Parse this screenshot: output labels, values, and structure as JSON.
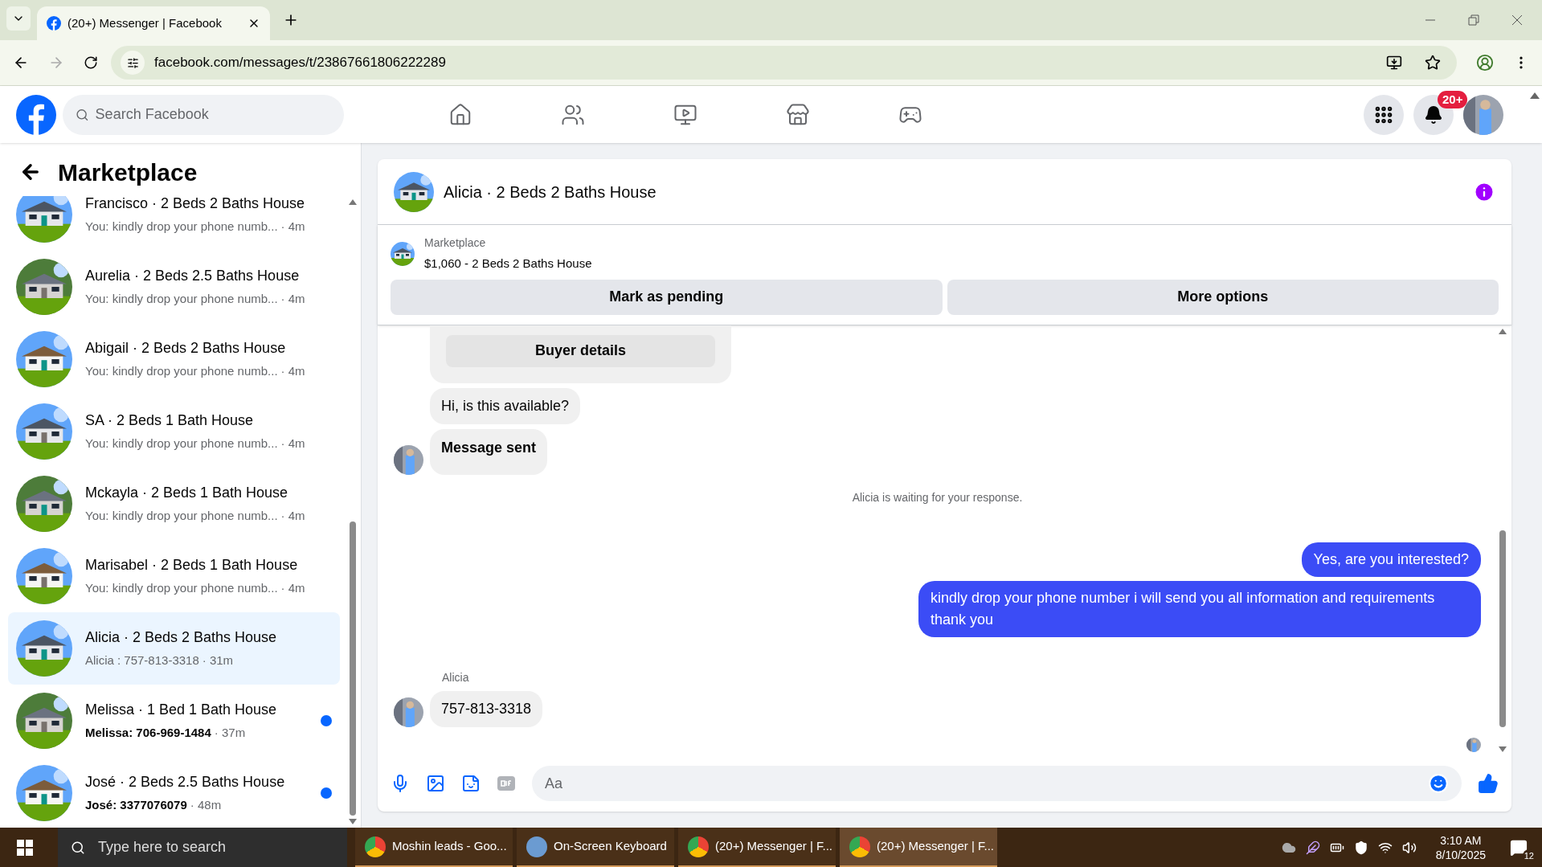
{
  "browser": {
    "tabs": [
      {
        "title": "(20+) Messenger | Facebook",
        "selected": true
      }
    ],
    "url": "facebook.com/messages/t/23867661806222289"
  },
  "header": {
    "search_placeholder": "Search Facebook",
    "notification_badge": "20+"
  },
  "sidebar": {
    "title": "Marketplace",
    "conversations": [
      {
        "name": "Francisco · 2 Beds 2 Baths House",
        "preview": "You: kindly drop your phone numb...",
        "time": "· 4m",
        "selected": false,
        "unread": false
      },
      {
        "name": "Aurelia · 2 Beds 2.5 Baths House",
        "preview": "You: kindly drop your phone numb...",
        "time": "· 4m",
        "selected": false,
        "unread": false
      },
      {
        "name": "Abigail · 2 Beds 2 Baths House",
        "preview": "You: kindly drop your phone numb...",
        "time": "· 4m",
        "selected": false,
        "unread": false
      },
      {
        "name": "SA · 2 Beds 1 Bath House",
        "preview": "You: kindly drop your phone numb...",
        "time": "· 4m",
        "selected": false,
        "unread": false
      },
      {
        "name": "Mckayla · 2 Beds 1 Bath House",
        "preview": "You: kindly drop your phone numb...",
        "time": "· 4m",
        "selected": false,
        "unread": false
      },
      {
        "name": "Marisabel · 2 Beds 1 Bath House",
        "preview": "You: kindly drop your phone numb...",
        "time": "· 4m",
        "selected": false,
        "unread": false
      },
      {
        "name": "Alicia · 2 Beds 2 Baths House",
        "preview": "Alicia : 757-813-3318",
        "time": "· 31m",
        "selected": true,
        "unread": false
      },
      {
        "name": "Melissa · 1 Bed 1 Bath House",
        "preview": "Melissa: 706-969-1484",
        "time": "· 37m",
        "selected": false,
        "unread": true
      },
      {
        "name": "José · 2 Beds 2.5 Baths House",
        "preview": "José: 3377076079",
        "time": "· 48m",
        "selected": false,
        "unread": true
      }
    ]
  },
  "chat": {
    "title": "Alicia · 2 Beds 2 Baths House",
    "listing_label": "Marketplace",
    "listing": "$1,060 - 2 Beds 2 Baths House",
    "actions": [
      "Mark as pending",
      "More options"
    ],
    "messages": [
      {
        "kind": "card",
        "text": "Buyer details"
      },
      {
        "kind": "incoming",
        "text": "Hi, is this available?",
        "bold": false,
        "avatar": false
      },
      {
        "kind": "incoming",
        "text": "Message sent",
        "bold": true,
        "avatar": true
      },
      {
        "kind": "status",
        "text": "Alicia is waiting for your response."
      },
      {
        "kind": "outgoing",
        "text": "Yes, are you interested?"
      },
      {
        "kind": "outgoing",
        "text": "kindly drop your phone number i will send you all information and requirements thank you"
      },
      {
        "kind": "sender",
        "text": "Alicia"
      },
      {
        "kind": "incoming",
        "text": "757-813-3318",
        "bold": false,
        "avatar": true
      }
    ],
    "composer_placeholder": "Aa"
  },
  "taskbar": {
    "search_placeholder": "Type here to search",
    "apps": [
      {
        "label": "Moshin leads - Goo...",
        "selected": false
      },
      {
        "label": "On-Screen Keyboard",
        "selected": false
      },
      {
        "label": "(20+) Messenger | F...",
        "selected": false
      },
      {
        "label": "(20+) Messenger | F...",
        "selected": true
      }
    ],
    "time": "3:10 AM",
    "date": "8/10/2025",
    "notifications": "12"
  }
}
